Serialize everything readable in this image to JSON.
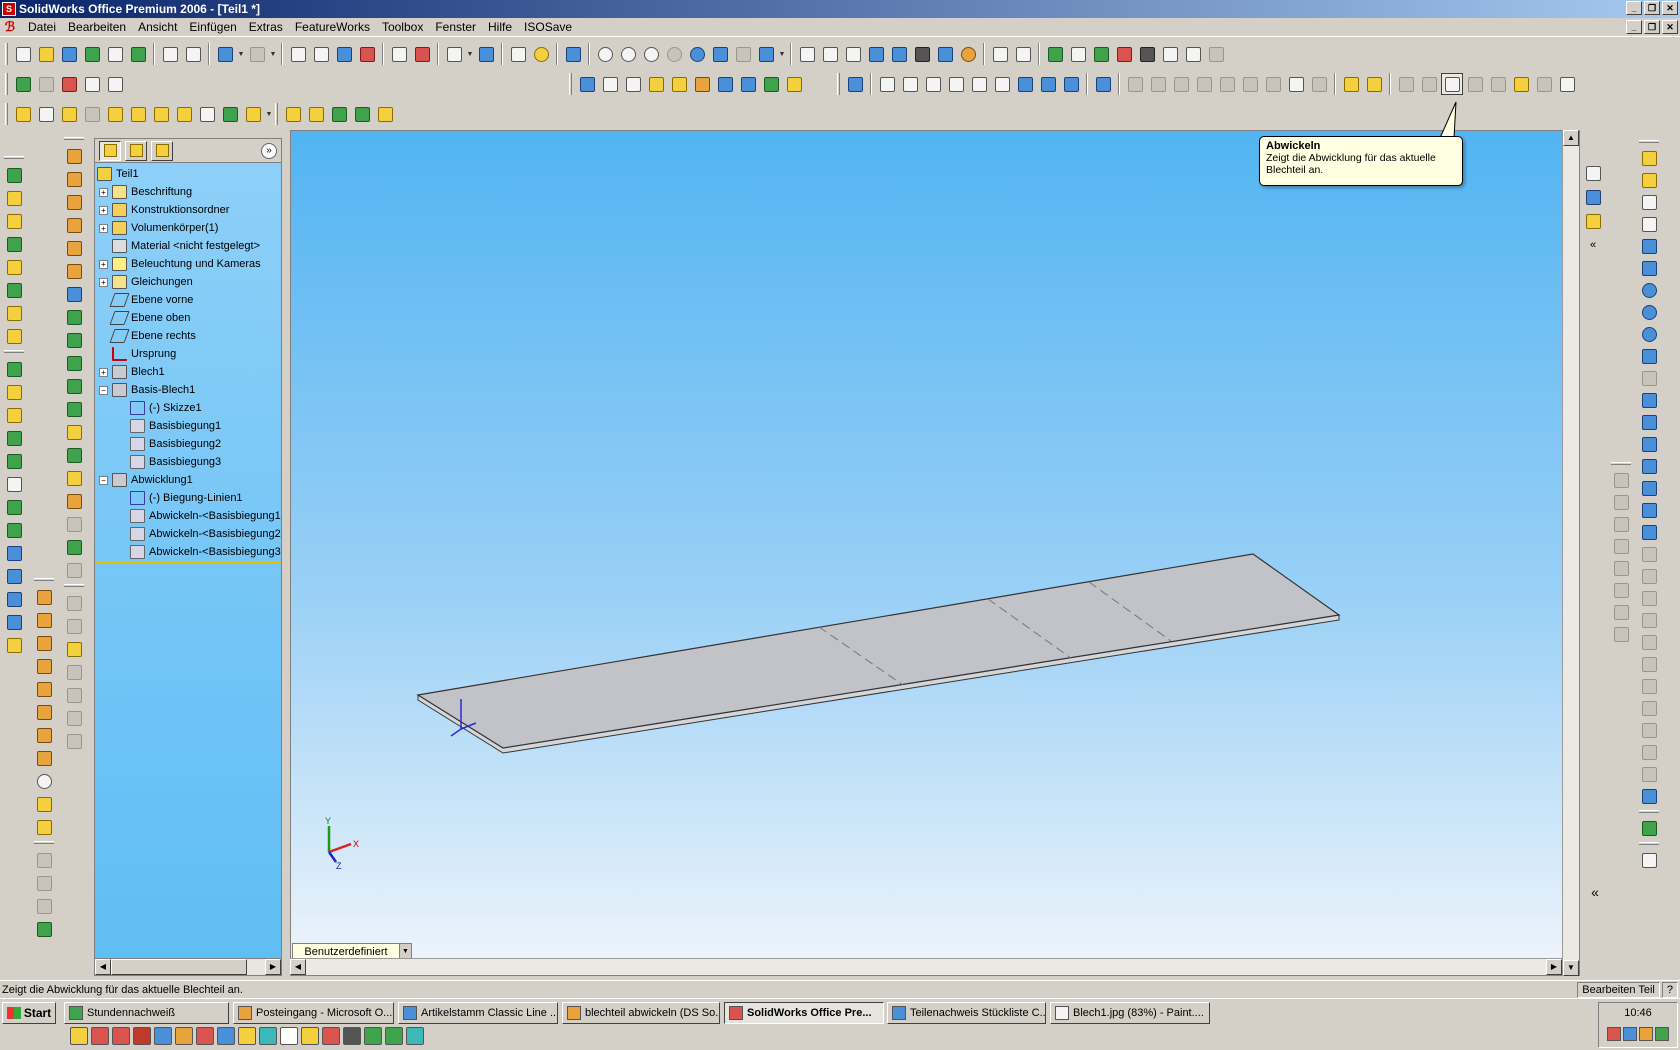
{
  "window": {
    "title": "SolidWorks Office Premium 2006 - [Teil1 *]",
    "controls": [
      "_",
      "❐",
      "✕"
    ]
  },
  "menu": {
    "items": [
      "Datei",
      "Bearbeiten",
      "Ansicht",
      "Einfügen",
      "Extras",
      "FeatureWorks",
      "Toolbox",
      "Fenster",
      "Hilfe",
      "ISOSave"
    ]
  },
  "feature_tree": {
    "expand_button": "»",
    "items": [
      {
        "label": "Teil1",
        "indent": 0,
        "expander": "",
        "icon": "part-icon"
      },
      {
        "label": "Beschriftung",
        "indent": 1,
        "expander": "+",
        "icon": "annotations-icon"
      },
      {
        "label": "Konstruktionsordner",
        "indent": 1,
        "expander": "+",
        "icon": "design-folder-icon"
      },
      {
        "label": "Volumenkörper(1)",
        "indent": 1,
        "expander": "+",
        "icon": "solid-bodies-icon"
      },
      {
        "label": "Material <nicht festgelegt>",
        "indent": 1,
        "expander": "",
        "icon": "material-icon"
      },
      {
        "label": "Beleuchtung und Kameras",
        "indent": 1,
        "expander": "+",
        "icon": "lighting-icon"
      },
      {
        "label": "Gleichungen",
        "indent": 1,
        "expander": "+",
        "icon": "equations-icon"
      },
      {
        "label": "Ebene vorne",
        "indent": 1,
        "expander": "",
        "icon": "plane-icon"
      },
      {
        "label": "Ebene oben",
        "indent": 1,
        "expander": "",
        "icon": "plane-icon"
      },
      {
        "label": "Ebene rechts",
        "indent": 1,
        "expander": "",
        "icon": "plane-icon"
      },
      {
        "label": "Ursprung",
        "indent": 1,
        "expander": "",
        "icon": "origin-icon"
      },
      {
        "label": "Blech1",
        "indent": 1,
        "expander": "+",
        "icon": "sheet-metal-icon"
      },
      {
        "label": "Basis-Blech1",
        "indent": 1,
        "expander": "−",
        "icon": "base-flange-icon"
      },
      {
        "label": "(-) Skizze1",
        "indent": 2,
        "expander": "",
        "icon": "sketch-icon"
      },
      {
        "label": "Basisbiegung1",
        "indent": 2,
        "expander": "",
        "icon": "bend-icon"
      },
      {
        "label": "Basisbiegung2",
        "indent": 2,
        "expander": "",
        "icon": "bend-icon"
      },
      {
        "label": "Basisbiegung3",
        "indent": 2,
        "expander": "",
        "icon": "bend-icon"
      },
      {
        "label": "Abwicklung1",
        "indent": 1,
        "expander": "−",
        "icon": "flat-pattern-icon"
      },
      {
        "label": "(-) Biegung-Linien1",
        "indent": 2,
        "expander": "",
        "icon": "sketch-icon"
      },
      {
        "label": "Abwickeln-<Basisbiegung1",
        "indent": 2,
        "expander": "",
        "icon": "bend-icon"
      },
      {
        "label": "Abwickeln-<Basisbiegung2",
        "indent": 2,
        "expander": "",
        "icon": "bend-icon"
      },
      {
        "label": "Abwickeln-<Basisbiegung3",
        "indent": 2,
        "expander": "",
        "icon": "bend-icon"
      }
    ]
  },
  "tooltip": {
    "title": "Abwickeln",
    "text": "Zeigt die Abwicklung für das aktuelle Blechteil an."
  },
  "viewport": {
    "view_dropdown": "Benutzerdefiniert",
    "triad_labels": {
      "x": "X",
      "y": "Y",
      "z": "Z"
    }
  },
  "statusbar": {
    "message": "Zeigt die Abwicklung für das aktuelle Blechteil an.",
    "mode": "Bearbeiten Teil",
    "help_icon": "?"
  },
  "taskbar": {
    "start_label": "Start",
    "tasks": [
      {
        "label": "Stundennachweiß",
        "active": false,
        "icon": "excel-icon"
      },
      {
        "label": "Posteingang - Microsoft O...",
        "active": false,
        "icon": "outlook-icon"
      },
      {
        "label": "Artikelstamm  Classic Line ...",
        "active": false,
        "icon": "app-icon"
      },
      {
        "label": "blechteil abwickeln (DS So...",
        "active": false,
        "icon": "firefox-icon"
      },
      {
        "label": "SolidWorks Office Pre...",
        "active": true,
        "icon": "solidworks-icon"
      },
      {
        "label": "Teilenachweis Stückliste C...",
        "active": false,
        "icon": "app-icon"
      },
      {
        "label": "Blech1.jpg (83%) - Paint....",
        "active": false,
        "icon": "paint-icon"
      }
    ],
    "clock": "10:46"
  },
  "colors": {
    "titlebar_start": "#0a246a",
    "titlebar_end": "#a6caf0",
    "feature_tree_bg": "#6cc4f6",
    "viewport_top": "#52b4f2",
    "viewport_bottom": "#f0f5fb",
    "tooltip_bg": "#ffffe1",
    "part_face": "#c2c3c8"
  }
}
